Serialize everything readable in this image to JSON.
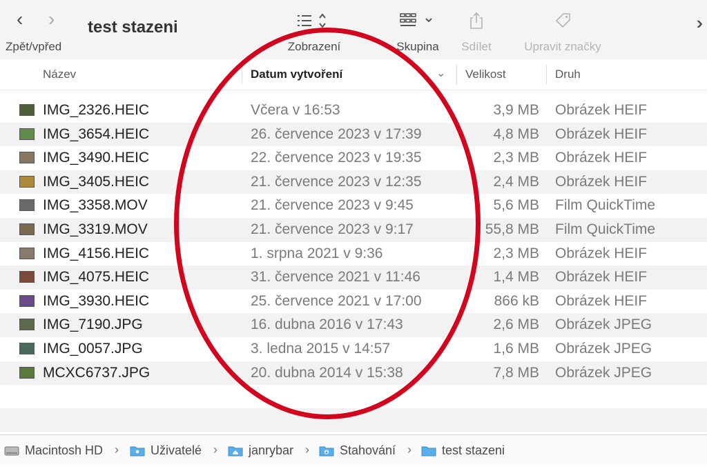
{
  "toolbar": {
    "title": "test stazeni",
    "nav_label": "Zpět/vpřed",
    "view_label": "Zobrazení",
    "group_label": "Skupina",
    "share_label": "Sdílet",
    "tags_label": "Upravit značky",
    "more_icon": "double-chevron-right-icon"
  },
  "columns": {
    "name": "Název",
    "date": "Datum vytvoření",
    "size": "Velikost",
    "kind": "Druh"
  },
  "files": [
    {
      "name": "IMG_2326.HEIC",
      "date": "Včera v 16:53",
      "size": "3,9 MB",
      "kind": "Obrázek HEIF",
      "thumb_color": "#4f5f3c"
    },
    {
      "name": "IMG_3654.HEIC",
      "date": "26. července 2023 v 17:39",
      "size": "4,8 MB",
      "kind": "Obrázek HEIF",
      "thumb_color": "#5f8a4a"
    },
    {
      "name": "IMG_3490.HEIC",
      "date": "22. července 2023 v 19:35",
      "size": "2,3 MB",
      "kind": "Obrázek HEIF",
      "thumb_color": "#8a7560"
    },
    {
      "name": "IMG_3405.HEIC",
      "date": "21. července 2023 v 12:35",
      "size": "2,4 MB",
      "kind": "Obrázek HEIF",
      "thumb_color": "#b08a3c"
    },
    {
      "name": "IMG_3358.MOV",
      "date": "21. července 2023 v 9:45",
      "size": "5,6 MB",
      "kind": "Film QuickTime",
      "thumb_color": "#6a6a6a"
    },
    {
      "name": "IMG_3319.MOV",
      "date": "21. července 2023 v 9:17",
      "size": "55,8 MB",
      "kind": "Film QuickTime",
      "thumb_color": "#7a6a50"
    },
    {
      "name": "IMG_4156.HEIC",
      "date": "1. srpna 2021 v 9:36",
      "size": "2,3 MB",
      "kind": "Obrázek HEIF",
      "thumb_color": "#8a7a6a"
    },
    {
      "name": "IMG_4075.HEIC",
      "date": "31. července 2021 v 11:46",
      "size": "1,4 MB",
      "kind": "Obrázek HEIF",
      "thumb_color": "#7a4a3a"
    },
    {
      "name": "IMG_3930.HEIC",
      "date": "25. července 2021 v 17:00",
      "size": "866 kB",
      "kind": "Obrázek HEIF",
      "thumb_color": "#6a4a8a"
    },
    {
      "name": "IMG_7190.JPG",
      "date": "16. dubna 2016 v 17:43",
      "size": "2,6 MB",
      "kind": "Obrázek JPEG",
      "thumb_color": "#5a6a4a"
    },
    {
      "name": "IMG_0057.JPG",
      "date": "3. ledna 2015 v 14:57",
      "size": "1,6 MB",
      "kind": "Obrázek JPEG",
      "thumb_color": "#4a6a5a"
    },
    {
      "name": "MCXC6737.JPG",
      "date": "20. dubna 2014 v 15:38",
      "size": "7,8 MB",
      "kind": "Obrázek JPEG",
      "thumb_color": "#5a7a3a"
    }
  ],
  "pathbar": {
    "items": [
      "Macintosh HD",
      "Uživatelé",
      "janrybar",
      "Stahování",
      "test stazeni"
    ]
  },
  "colors": {
    "annotation": "#d2051e",
    "folder_blue": "#5aaee8"
  }
}
